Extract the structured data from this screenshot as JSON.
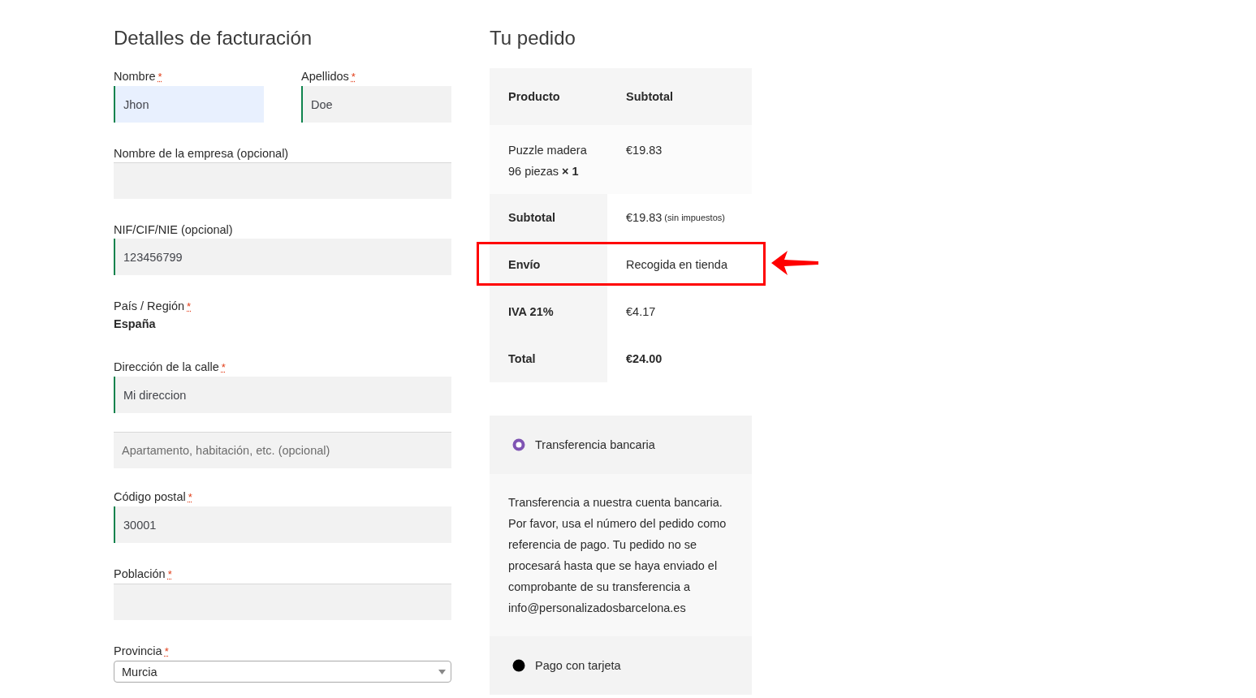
{
  "billing": {
    "title": "Detalles de facturación",
    "name_row": [
      {
        "label": "Nombre",
        "required_mark": "*",
        "value": "Jhon",
        "validated": true,
        "focused": true
      },
      {
        "label": "Apellidos",
        "required_mark": "*",
        "value": "Doe",
        "validated": true,
        "focused": false
      }
    ],
    "fields": [
      {
        "kind": "text",
        "label": "Nombre de la empresa (opcional)",
        "validated": false
      },
      {
        "kind": "text",
        "label": "NIF/CIF/NIE (opcional)",
        "value": "123456799",
        "validated": true
      },
      {
        "kind": "static",
        "label": "País / Región",
        "required_mark": "*",
        "value": "España"
      },
      {
        "kind": "text",
        "label": "Dirección de la calle",
        "required_mark": "*",
        "value": "Mi direccion",
        "validated": true
      },
      {
        "kind": "text",
        "placeholder": "Apartamento, habitación, etc. (opcional)",
        "validated": false
      },
      {
        "kind": "text",
        "label": "Código postal",
        "required_mark": "*",
        "value": "30001",
        "validated": true
      },
      {
        "kind": "text",
        "label": "Población",
        "required_mark": "*",
        "validated": false
      },
      {
        "kind": "select",
        "label": "Provincia",
        "required_mark": "*",
        "value": "Murcia"
      }
    ]
  },
  "order": {
    "title": "Tu pedido",
    "columns": [
      "Producto",
      "Subtotal"
    ],
    "items": [
      {
        "name": "Puzzle madera 96 piezas",
        "quantity": "× 1",
        "subtotal": "€19.83"
      }
    ],
    "totals": [
      {
        "label": "Subtotal",
        "value": "€19.83",
        "note": "(sin impuestos)",
        "strong": false,
        "highlighted": false
      },
      {
        "label": "Envío",
        "value": "Recogida en tienda",
        "strong": false,
        "highlighted": true
      },
      {
        "label": "IVA 21%",
        "value": "€4.17",
        "strong": false,
        "highlighted": false
      },
      {
        "label": "Total",
        "value": "€24.00",
        "strong": true,
        "highlighted": false
      }
    ]
  },
  "payment": {
    "methods": [
      {
        "label": "Transferencia bancaria",
        "selected": true,
        "description": "Transferencia a nuestra cuenta bancaria. Por favor, usa el número del pedido como referencia de pago. Tu pedido no se procesará hasta que se haya enviado el comprobante de su transferencia a info@personalizadosbarcelona.es"
      },
      {
        "label": "Pago con tarjeta",
        "selected": false
      }
    ]
  }
}
